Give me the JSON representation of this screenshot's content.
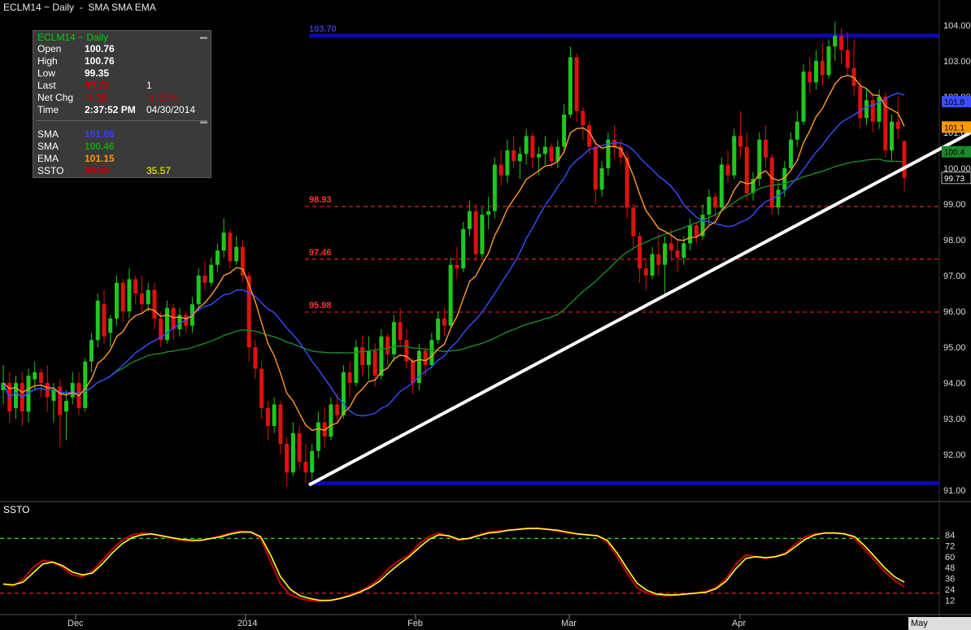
{
  "header": {
    "title": "ECLM14 ~ Daily  -  SMA SMA EMA"
  },
  "infobox": {
    "title": "ECLM14 ~ Daily",
    "rows": [
      {
        "label": "Open",
        "value": "100.76",
        "value2": "",
        "color": "#ffffff"
      },
      {
        "label": "High",
        "value": "100.76",
        "value2": "",
        "color": "#ffffff"
      },
      {
        "label": "Low",
        "value": "99.35",
        "value2": "",
        "color": "#ffffff"
      },
      {
        "label": "Last",
        "value": "99.73",
        "value2": "1",
        "color": "#cc0000"
      },
      {
        "label": "Net Chg",
        "value": "-1.35",
        "value2": "-1.33%",
        "color": "#cc0000"
      },
      {
        "label": "Time",
        "value": "2:37:52 PM",
        "value2": "04/30/2014",
        "color": "#ffffff"
      }
    ],
    "indicators": [
      {
        "label": "SMA",
        "value": "101.86",
        "value2": "",
        "color": "#3c3cff"
      },
      {
        "label": "SMA",
        "value": "100.46",
        "value2": "",
        "color": "#16a016"
      },
      {
        "label": "EMA",
        "value": "101.15",
        "value2": "",
        "color": "#ff9900"
      },
      {
        "label": "SSTO",
        "value": "26.92",
        "value2": "35.57",
        "color": "#cc0000",
        "color2": "#ffff00"
      }
    ]
  },
  "colors": {
    "up": "#1fc71f",
    "down": "#dd1111",
    "sma_blue": "#3c4cff",
    "sma_green": "#1a8a2a",
    "ema": "#ff9a2e",
    "trend": "#ffffff",
    "hline": "#0a0ab0",
    "dash": "#dd2222",
    "ssto_k": "#b80000",
    "ssto_d": "#ffff33",
    "ssto_dash_hi": "#22dd22",
    "ssto_dash_lo": "#dd2222"
  },
  "chart_data": [
    {
      "type": "candlestick",
      "ylim": [
        90.8,
        104.2
      ],
      "y_ticks": [
        "104.00",
        "103.00",
        "102.00",
        "101.00",
        "100.00",
        "99.00",
        "98.00",
        "97.00",
        "96.00",
        "95.00",
        "94.00",
        "93.00",
        "92.00",
        "91.00"
      ],
      "y_tick_values": [
        104,
        103,
        102,
        101,
        100,
        99,
        98,
        97,
        96,
        95,
        94,
        93,
        92,
        91
      ],
      "x_labels": [
        {
          "label": "Dec",
          "x": 93
        },
        {
          "label": "2014",
          "x": 302
        },
        {
          "label": "Feb",
          "x": 511
        },
        {
          "label": "Mar",
          "x": 700
        },
        {
          "label": "Apr",
          "x": 910
        }
      ],
      "x_last_label": "May",
      "horizontal_levels": [
        {
          "value": 103.7,
          "label": "103.70",
          "style": "solid"
        },
        {
          "value": 91.2,
          "label": "",
          "style": "solid"
        },
        {
          "value": 98.93,
          "label": "98.93",
          "style": "dashed"
        },
        {
          "value": 97.46,
          "label": "97.46",
          "style": "dashed"
        },
        {
          "value": 95.98,
          "label": "95.98",
          "style": "dashed"
        }
      ],
      "trendline": {
        "from": [
          380,
          91.15
        ],
        "to": [
          1194,
          101.0
        ]
      },
      "right_badges": [
        {
          "value": 101.86,
          "label": "101.8",
          "color": "#3c4cff"
        },
        {
          "value": 101.15,
          "label": "101.1",
          "color": "#ff9900"
        },
        {
          "value": 100.46,
          "label": "100.4",
          "color": "#1a8a2a"
        },
        {
          "value": 99.73,
          "label": "99.73",
          "color": "#000000"
        }
      ],
      "candles": [
        [
          93.8,
          94.5,
          93.4,
          94.0
        ],
        [
          94.0,
          94.3,
          92.9,
          93.2
        ],
        [
          93.3,
          94.2,
          93.0,
          94.0
        ],
        [
          94.0,
          94.3,
          92.8,
          93.2
        ],
        [
          93.2,
          94.4,
          92.9,
          94.2
        ],
        [
          94.1,
          94.6,
          93.8,
          94.3
        ],
        [
          94.3,
          94.4,
          93.6,
          94.0
        ],
        [
          94.0,
          94.5,
          93.2,
          93.6
        ],
        [
          93.5,
          94.0,
          92.9,
          93.8
        ],
        [
          93.9,
          94.1,
          92.2,
          93.1
        ],
        [
          93.2,
          93.8,
          92.4,
          93.5
        ],
        [
          93.6,
          94.3,
          93.4,
          94.0
        ],
        [
          94.0,
          94.3,
          93.1,
          93.3
        ],
        [
          93.3,
          94.7,
          93.2,
          94.6
        ],
        [
          94.6,
          95.4,
          94.3,
          95.2
        ],
        [
          95.2,
          96.5,
          95.0,
          96.3
        ],
        [
          96.2,
          96.6,
          95.1,
          95.3
        ],
        [
          95.4,
          95.9,
          95.0,
          95.8
        ],
        [
          95.8,
          97.0,
          95.6,
          96.8
        ],
        [
          96.8,
          96.9,
          95.7,
          96.0
        ],
        [
          96.0,
          97.2,
          95.8,
          96.9
        ],
        [
          96.9,
          97.0,
          96.2,
          96.5
        ],
        [
          96.5,
          97.0,
          95.9,
          96.2
        ],
        [
          96.2,
          96.8,
          96.0,
          96.6
        ],
        [
          96.6,
          96.8,
          95.5,
          95.8
        ],
        [
          95.8,
          96.0,
          95.0,
          95.2
        ],
        [
          95.2,
          96.3,
          95.1,
          96.1
        ],
        [
          96.1,
          96.2,
          95.2,
          95.5
        ],
        [
          95.5,
          96.1,
          95.3,
          95.9
        ],
        [
          95.9,
          96.0,
          95.4,
          95.6
        ],
        [
          95.6,
          96.4,
          95.4,
          96.2
        ],
        [
          96.2,
          97.2,
          96.0,
          97.0
        ],
        [
          97.0,
          97.4,
          96.6,
          96.8
        ],
        [
          96.8,
          97.5,
          96.7,
          97.3
        ],
        [
          97.3,
          97.9,
          97.1,
          97.7
        ],
        [
          97.7,
          98.6,
          97.5,
          98.2
        ],
        [
          98.2,
          98.3,
          97.2,
          97.4
        ],
        [
          97.4,
          98.1,
          97.3,
          97.8
        ],
        [
          97.8,
          98.0,
          96.8,
          97.0
        ],
        [
          97.0,
          97.1,
          94.6,
          95.0
        ],
        [
          95.0,
          95.2,
          94.1,
          94.4
        ],
        [
          94.4,
          94.6,
          93.0,
          93.3
        ],
        [
          93.3,
          93.5,
          92.4,
          92.8
        ],
        [
          92.8,
          93.6,
          92.6,
          93.4
        ],
        [
          93.4,
          93.5,
          92.0,
          92.3
        ],
        [
          92.3,
          92.5,
          91.1,
          91.5
        ],
        [
          91.5,
          92.9,
          91.4,
          92.6
        ],
        [
          92.6,
          92.8,
          91.6,
          91.8
        ],
        [
          91.8,
          92.3,
          91.2,
          91.5
        ],
        [
          91.5,
          92.3,
          91.3,
          92.1
        ],
        [
          92.1,
          93.2,
          91.9,
          92.9
        ],
        [
          92.9,
          93.3,
          92.2,
          92.5
        ],
        [
          92.5,
          93.6,
          92.4,
          93.4
        ],
        [
          93.4,
          93.7,
          92.9,
          93.1
        ],
        [
          93.1,
          94.5,
          93.0,
          94.3
        ],
        [
          94.3,
          94.6,
          93.6,
          94.0
        ],
        [
          94.0,
          95.2,
          93.9,
          95.0
        ],
        [
          95.0,
          95.3,
          94.2,
          94.5
        ],
        [
          94.5,
          95.3,
          94.1,
          94.9
        ],
        [
          94.9,
          95.1,
          93.9,
          94.2
        ],
        [
          94.2,
          95.5,
          94.1,
          95.3
        ],
        [
          95.3,
          95.4,
          94.5,
          94.8
        ],
        [
          94.8,
          95.9,
          94.6,
          95.7
        ],
        [
          95.7,
          96.1,
          95.0,
          95.2
        ],
        [
          95.2,
          95.5,
          94.4,
          94.6
        ],
        [
          94.6,
          94.7,
          93.7,
          94.0
        ],
        [
          94.0,
          95.1,
          93.8,
          94.9
        ],
        [
          94.9,
          95.0,
          94.2,
          94.5
        ],
        [
          94.5,
          95.4,
          94.4,
          95.2
        ],
        [
          95.2,
          96.0,
          95.1,
          95.8
        ],
        [
          95.8,
          96.1,
          95.3,
          95.6
        ],
        [
          95.6,
          97.5,
          95.5,
          97.3
        ],
        [
          97.3,
          97.8,
          96.9,
          97.2
        ],
        [
          97.2,
          98.5,
          97.1,
          98.3
        ],
        [
          98.3,
          99.1,
          98.1,
          98.8
        ],
        [
          98.8,
          99.0,
          97.4,
          97.6
        ],
        [
          97.6,
          98.9,
          97.5,
          98.7
        ],
        [
          98.7,
          99.2,
          98.3,
          98.8
        ],
        [
          98.8,
          100.3,
          98.6,
          100.1
        ],
        [
          100.1,
          100.5,
          99.5,
          99.8
        ],
        [
          99.8,
          100.8,
          99.6,
          100.5
        ],
        [
          100.5,
          100.9,
          100.0,
          100.2
        ],
        [
          100.2,
          100.6,
          99.7,
          100.4
        ],
        [
          100.4,
          101.1,
          100.1,
          100.9
        ],
        [
          100.9,
          101.0,
          100.0,
          100.3
        ],
        [
          100.3,
          100.6,
          99.8,
          100.4
        ],
        [
          100.4,
          100.9,
          100.1,
          100.6
        ],
        [
          100.6,
          100.7,
          100.0,
          100.2
        ],
        [
          100.2,
          100.8,
          100.0,
          100.6
        ],
        [
          100.6,
          101.8,
          100.5,
          101.5
        ],
        [
          101.5,
          103.4,
          101.4,
          103.1
        ],
        [
          103.1,
          103.2,
          101.3,
          101.6
        ],
        [
          101.6,
          101.7,
          100.8,
          101.2
        ],
        [
          101.2,
          101.3,
          100.4,
          100.6
        ],
        [
          100.6,
          100.8,
          99.0,
          99.4
        ],
        [
          99.4,
          100.2,
          99.2,
          100.0
        ],
        [
          100.0,
          101.0,
          99.8,
          100.8
        ],
        [
          100.8,
          101.2,
          100.3,
          100.6
        ],
        [
          100.6,
          100.8,
          100.1,
          100.3
        ],
        [
          100.3,
          100.5,
          98.6,
          98.9
        ],
        [
          98.9,
          99.0,
          97.7,
          98.1
        ],
        [
          98.1,
          98.2,
          96.8,
          97.2
        ],
        [
          97.2,
          97.5,
          96.6,
          97.0
        ],
        [
          97.0,
          97.8,
          96.9,
          97.6
        ],
        [
          97.6,
          98.2,
          97.0,
          97.3
        ],
        [
          97.3,
          98.1,
          96.5,
          97.9
        ],
        [
          97.9,
          98.3,
          97.4,
          97.7
        ],
        [
          97.7,
          98.0,
          97.1,
          97.5
        ],
        [
          97.5,
          98.1,
          97.3,
          97.9
        ],
        [
          97.9,
          98.6,
          97.7,
          98.4
        ],
        [
          98.4,
          98.5,
          97.9,
          98.1
        ],
        [
          98.1,
          99.0,
          98.0,
          98.7
        ],
        [
          98.7,
          99.4,
          98.4,
          99.2
        ],
        [
          99.2,
          99.3,
          98.6,
          98.9
        ],
        [
          98.9,
          100.3,
          98.8,
          100.1
        ],
        [
          100.1,
          100.5,
          99.6,
          99.8
        ],
        [
          99.8,
          101.1,
          99.7,
          100.9
        ],
        [
          100.9,
          101.6,
          100.3,
          100.6
        ],
        [
          100.6,
          101.0,
          99.1,
          99.3
        ],
        [
          99.3,
          99.9,
          99.1,
          99.7
        ],
        [
          99.7,
          101.0,
          99.5,
          100.8
        ],
        [
          100.8,
          101.2,
          100.0,
          100.3
        ],
        [
          100.3,
          100.4,
          98.7,
          98.9
        ],
        [
          98.9,
          99.6,
          98.7,
          99.4
        ],
        [
          99.4,
          100.2,
          99.2,
          100.0
        ],
        [
          100.0,
          101.0,
          99.9,
          100.8
        ],
        [
          100.8,
          101.6,
          100.6,
          101.3
        ],
        [
          101.3,
          102.9,
          101.2,
          102.7
        ],
        [
          102.7,
          103.1,
          102.1,
          102.4
        ],
        [
          102.4,
          103.3,
          102.2,
          103.0
        ],
        [
          103.0,
          103.5,
          102.3,
          102.6
        ],
        [
          102.6,
          103.6,
          102.5,
          103.4
        ],
        [
          103.4,
          104.1,
          103.0,
          103.7
        ],
        [
          103.7,
          103.9,
          102.9,
          103.3
        ],
        [
          103.3,
          103.8,
          102.6,
          102.8
        ],
        [
          102.8,
          103.6,
          102.0,
          102.3
        ],
        [
          102.3,
          102.5,
          101.1,
          101.4
        ],
        [
          101.4,
          102.2,
          101.2,
          101.9
        ],
        [
          101.9,
          102.1,
          101.0,
          101.3
        ],
        [
          101.3,
          102.2,
          101.1,
          102.0
        ],
        [
          102.0,
          102.1,
          100.3,
          100.5
        ],
        [
          100.5,
          101.5,
          100.2,
          101.3
        ],
        [
          101.3,
          102.0,
          100.8,
          101.1
        ],
        [
          100.76,
          100.76,
          99.35,
          99.73
        ]
      ]
    },
    {
      "type": "line",
      "name": "SSTO",
      "ylim": [
        0,
        100
      ],
      "y_ticks": [
        "84",
        "72",
        "60",
        "48",
        "36",
        "24",
        "12"
      ],
      "y_tick_values": [
        84,
        72,
        60,
        48,
        36,
        24,
        12
      ],
      "levels": [
        {
          "value": 80,
          "color": "#22dd22"
        },
        {
          "value": 20,
          "color": "#dd2222"
        }
      ],
      "k": [
        30,
        28,
        35,
        48,
        56,
        54,
        48,
        40,
        38,
        44,
        56,
        68,
        78,
        84,
        86,
        85,
        82,
        80,
        78,
        77,
        78,
        80,
        83,
        86,
        88,
        87,
        80,
        55,
        30,
        18,
        14,
        12,
        11,
        12,
        14,
        18,
        22,
        28,
        36,
        48,
        56,
        62,
        74,
        82,
        86,
        82,
        78,
        80,
        84,
        87,
        88,
        89,
        90,
        91,
        91,
        90,
        88,
        86,
        85,
        84,
        83,
        76,
        60,
        42,
        26,
        20,
        18,
        17,
        18,
        19,
        20,
        22,
        26,
        36,
        52,
        62,
        60,
        58,
        60,
        64,
        74,
        82,
        85,
        86,
        86,
        85,
        80,
        68,
        56,
        44,
        34,
        27
      ],
      "d": [
        30,
        29,
        32,
        42,
        52,
        54,
        50,
        43,
        40,
        42,
        52,
        64,
        74,
        81,
        84,
        85,
        83,
        81,
        79,
        78,
        78,
        80,
        82,
        85,
        87,
        87,
        82,
        62,
        38,
        24,
        17,
        14,
        12,
        12,
        14,
        17,
        21,
        26,
        33,
        43,
        52,
        60,
        70,
        79,
        84,
        83,
        79,
        80,
        83,
        86,
        87,
        89,
        90,
        91,
        91,
        90,
        89,
        87,
        85,
        84,
        83,
        78,
        64,
        47,
        31,
        23,
        19,
        18,
        18,
        19,
        20,
        21,
        25,
        33,
        47,
        58,
        60,
        59,
        60,
        63,
        71,
        79,
        84,
        86,
        86,
        85,
        82,
        72,
        60,
        48,
        38,
        32
      ]
    }
  ]
}
